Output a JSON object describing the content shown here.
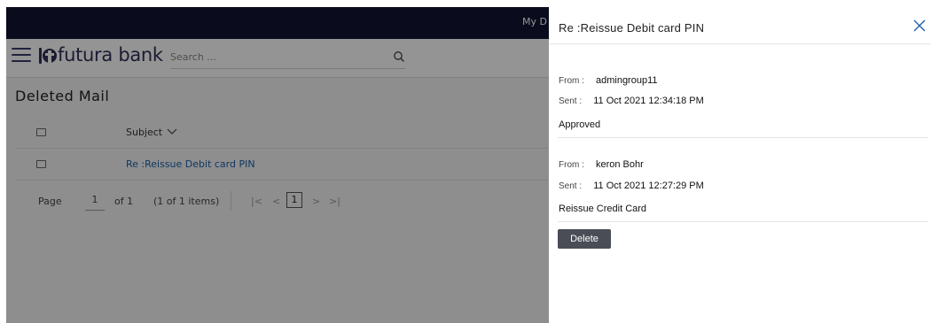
{
  "app": {
    "topbar_link": "My D",
    "brand": "futura bank",
    "search": {
      "placeholder": "Search ..."
    },
    "page_title": "Deleted Mail",
    "table": {
      "header_subject": "Subject",
      "rows": [
        {
          "subject": "Re :Reissue Debit card PIN"
        }
      ]
    },
    "pager": {
      "page_label": "Page",
      "page_value": "1",
      "of_label": "of 1",
      "items_label": "(1 of 1 items)",
      "first": "|<",
      "prev": "<",
      "current": "1",
      "next": ">",
      "last": ">|"
    }
  },
  "drawer": {
    "title": "Re :Reissue Debit card PIN",
    "messages": [
      {
        "from_label": "From :",
        "from_value": "admingroup11",
        "sent_label": "Sent :",
        "sent_value": "11 Oct 2021 12:34:18 PM",
        "body": "Approved"
      },
      {
        "from_label": "From :",
        "from_value": "keron Bohr",
        "sent_label": "Sent :",
        "sent_value": "11 Oct 2021 12:27:29 PM",
        "body": "Reissue Credit Card"
      }
    ],
    "delete_label": "Delete"
  },
  "colors": {
    "topbar": "#121433",
    "link": "#1d5fa8",
    "close_icon": "#1d5fa8",
    "delete_button": "#4a4d56"
  }
}
